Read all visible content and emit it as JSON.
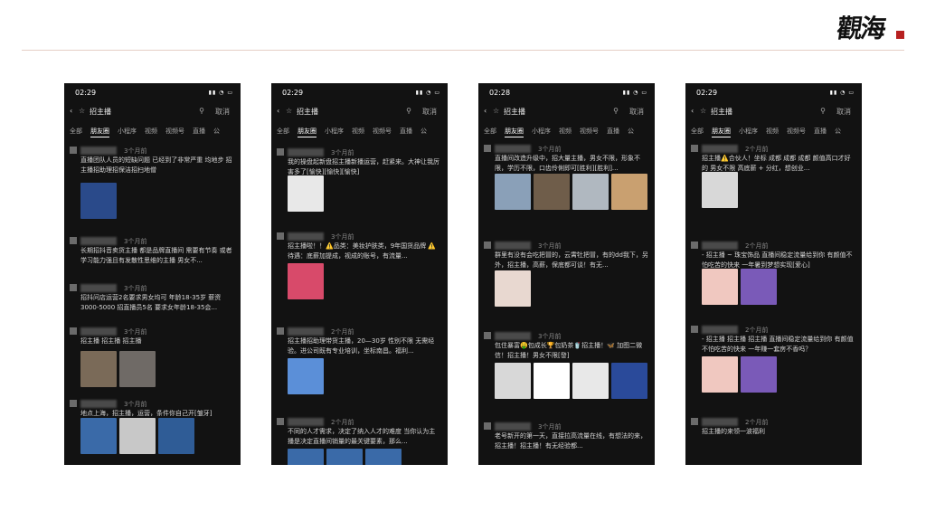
{
  "brand": {
    "logo_text": "觀海"
  },
  "phones": [
    {
      "time": "02:29",
      "search": {
        "back": "‹",
        "star": "☆",
        "query": "招主播",
        "mic": "⚲",
        "cancel": "取消"
      },
      "tabs": [
        "全部",
        "朋友圈",
        "小程序",
        "视频",
        "视频号",
        "直播",
        "公"
      ],
      "posts": [
        {
          "time": "3个月前",
          "text": "直播团队人员的短缺问题 已经到了非常严重 均地步 招主播招助理招保洁招扫地僧",
          "colors": [
            "#2a4a8a"
          ]
        },
        {
          "time": "3个月前",
          "text": "长期招抖音卖货主播 都是品牌直播间 需要有节奏 或者学习能力强且有发散性思维的主播 男女不...",
          "colors": []
        },
        {
          "time": "3个月前",
          "text": "招抖问店运营2名要求男女均可 年龄18-35岁 薪资3000-5000 招直播员5名 要求女年龄18-35会...",
          "colors": []
        },
        {
          "time": "3个月前",
          "text": "招主播 招主播 招主播",
          "colors": [
            "#7a6a58",
            "#6f6a66"
          ]
        },
        {
          "time": "3个月前",
          "text": "地点上海，招主播，运营，条件你自己开[皱牙]",
          "colors": [
            "#3a6aa8",
            "#c8c8c8",
            "#2f5c96"
          ]
        }
      ]
    },
    {
      "time": "02:29",
      "search": {
        "back": "‹",
        "star": "☆",
        "query": "招主播",
        "mic": "⚲",
        "cancel": "取消"
      },
      "tabs": [
        "全部",
        "朋友圈",
        "小程序",
        "视频",
        "视频号",
        "直播",
        "公"
      ],
      "posts": [
        {
          "time": "3个月前",
          "text": "我的操盘起新盘招主播新播运营，赶紧来。大神让我厉害多了[愉快][愉快][愉快]",
          "colors": [
            "#e8e8e8"
          ]
        },
        {
          "time": "3个月前",
          "text": "招主播啦！！⚠️品类：美妆护肤类，9年国货品牌 ⚠️待遇：底薪加提成，视成的账号，有流量...",
          "colors": [
            "#d84a6a"
          ]
        },
        {
          "time": "2个月前",
          "text": "招主播招助理带货主播，20—30岁 性别不限 无需经验。进公司既有专业培训，坐标南昌。福利...",
          "colors": [
            "#5b8fd8"
          ]
        },
        {
          "time": "2个月前",
          "text": "不同的人才需求，决定了纳入人才的难度 当你认为主播是决定直播间销量的最关键要素，那么...",
          "colors": [
            "#3a6aa8",
            "#3a6aa8",
            "#3a6aa8"
          ]
        }
      ]
    },
    {
      "time": "02:28",
      "search": {
        "back": "‹",
        "star": "☆",
        "query": "招主播",
        "mic": "⚲",
        "cancel": "取消"
      },
      "tabs": [
        "全部",
        "朋友圈",
        "小程序",
        "视频",
        "视频号",
        "直播",
        "公"
      ],
      "posts": [
        {
          "time": "3个月前",
          "text": "直播间改造升级中，招大量主播，男女不限，形象不限，学历不限，口齿伶俐即可[胜利][胜利]...",
          "colors": [
            "#8aa0b8",
            "#6f5d4a",
            "#b0b8c0",
            "#c9a070"
          ]
        },
        {
          "time": "3个月前",
          "text": "群里有没有会吃把冒的，云霄牡把冒，有的dd我下，另外，招主播，高薪，保底都可谈！有无...",
          "colors": [
            "#e8d8d0"
          ]
        },
        {
          "time": "3个月前",
          "text": "包住暴富🤑包成长🏆包奶茶🥤招主播！🦋 加图二微信！招主播！男女不限[發]",
          "colors": [
            "#d8d8d8",
            "#ffffff",
            "#e8e8e8",
            "#2a4a9a"
          ]
        },
        {
          "time": "3个月前",
          "text": "老号新开的第一天，直接拉高流量在线，有想法的来，招主播！招主播！有无经验都...",
          "colors": []
        }
      ]
    },
    {
      "time": "02:29",
      "search": {
        "back": "‹",
        "star": "☆",
        "query": "招主播",
        "mic": "⚲",
        "cancel": "取消"
      },
      "tabs": [
        "全部",
        "朋友圈",
        "小程序",
        "视频",
        "视频号",
        "直播",
        "公"
      ],
      "posts": [
        {
          "time": "2个月前",
          "text": "招主播⚠️合伙人！坐标 成都 成都 成都 颜值高口才好的 男女不限 高底薪 + 分红，想创业...",
          "colors": [
            "#d8d8d8"
          ]
        },
        {
          "time": "2个月前",
          "text": "- 招主播 ~ 珠宝饰品 直播间稳定流量给到你 有颜值不怕吃苦的快来 一年暑到梦想实现[爱心]",
          "colors": [
            "#f0c8c0",
            "#7a5ab8"
          ]
        },
        {
          "time": "2个月前",
          "text": "- 招主播 招主播 招主播 直播间稳定流量给到你 有颜值不怕吃苦的快来 一年赚一套房不香吗？",
          "colors": [
            "#f0c8c0",
            "#7a5ab8"
          ]
        },
        {
          "time": "2个月前",
          "text": "招主播的来领一波福利",
          "colors": []
        }
      ]
    }
  ]
}
